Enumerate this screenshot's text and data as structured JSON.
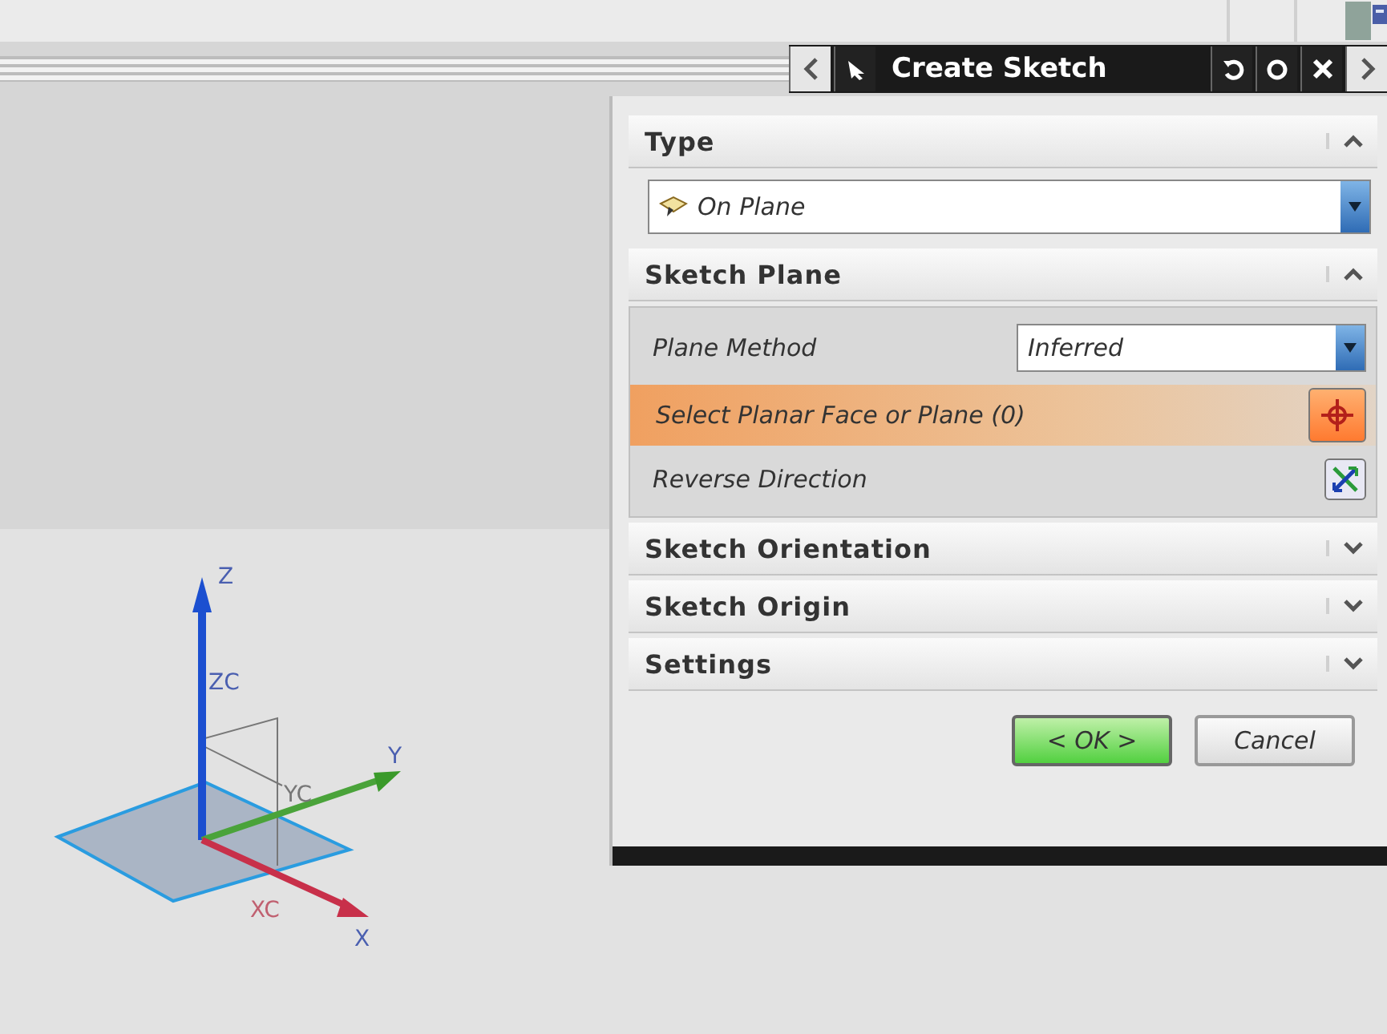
{
  "title_bar": {
    "title": "Create Sketch"
  },
  "sections": [
    {
      "kind": "type",
      "title": "Type",
      "expanded": true,
      "value": "On Plane"
    },
    {
      "kind": "plane",
      "title": "Sketch Plane",
      "expanded": true,
      "method_label": "Plane Method",
      "method_value": "Inferred",
      "select_label": "Select Planar Face or Plane (0)",
      "select_active": true,
      "reverse_label": "Reverse Direction"
    },
    {
      "kind": "plain",
      "title": "Sketch Orientation",
      "expanded": false
    },
    {
      "kind": "plain",
      "title": "Sketch Origin",
      "expanded": false
    },
    {
      "kind": "plain",
      "title": "Settings",
      "expanded": false
    }
  ],
  "buttons": [
    {
      "label": "< OK >",
      "default": true
    },
    {
      "label": "Cancel",
      "default": false
    }
  ],
  "triad": {
    "labels": [
      "Z",
      "ZC",
      "YC",
      "Y",
      "XC",
      "X"
    ]
  }
}
